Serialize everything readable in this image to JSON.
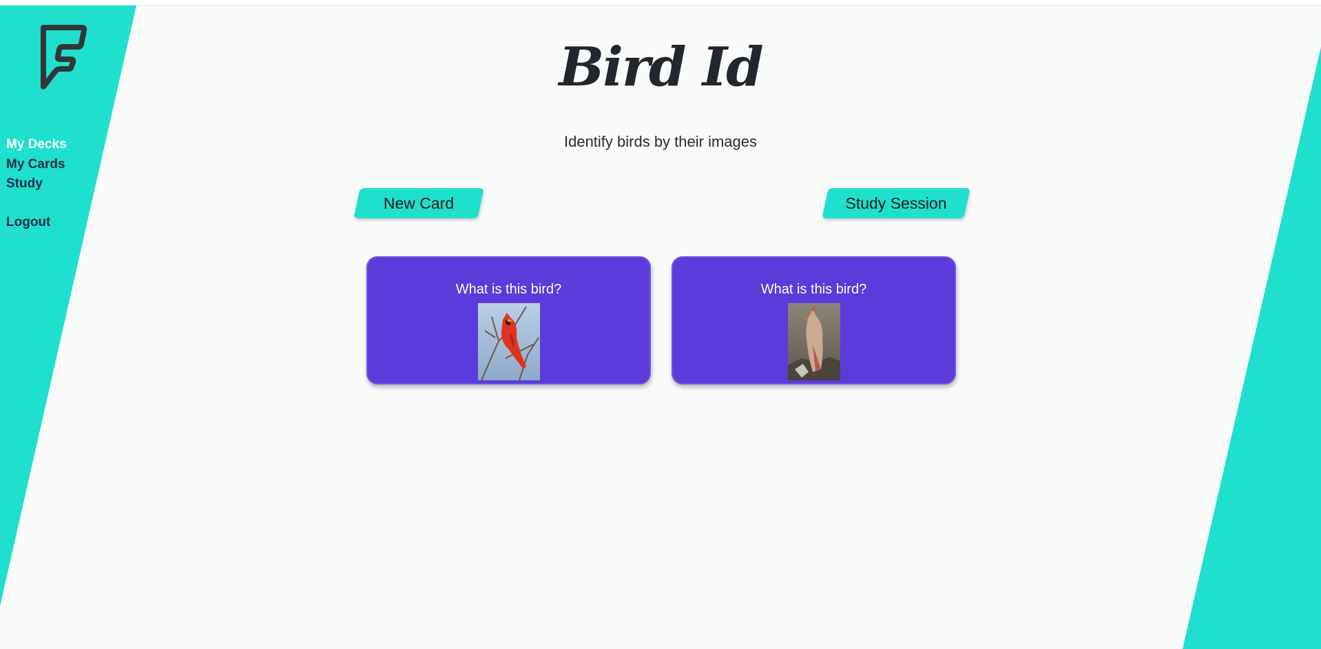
{
  "app": {
    "title": "Bird Id",
    "subtitle": "Identify birds by their images"
  },
  "sidebar": {
    "items": [
      {
        "label": "My Decks",
        "active": true
      },
      {
        "label": "My Cards",
        "active": false
      },
      {
        "label": "Study",
        "active": false
      },
      {
        "label": "Logout",
        "active": false
      }
    ]
  },
  "actions": {
    "new_card": "New Card",
    "study_session": "Study Session"
  },
  "cards": [
    {
      "question": "What is this bird?",
      "image": "male-cardinal-photo"
    },
    {
      "question": "What is this bird?",
      "image": "female-cardinal-photo"
    }
  ],
  "colors": {
    "accent_teal": "#1ee0cd",
    "card_purple": "#5c3bdb",
    "text_dark": "#1f2a44",
    "background": "#f9fafa"
  }
}
